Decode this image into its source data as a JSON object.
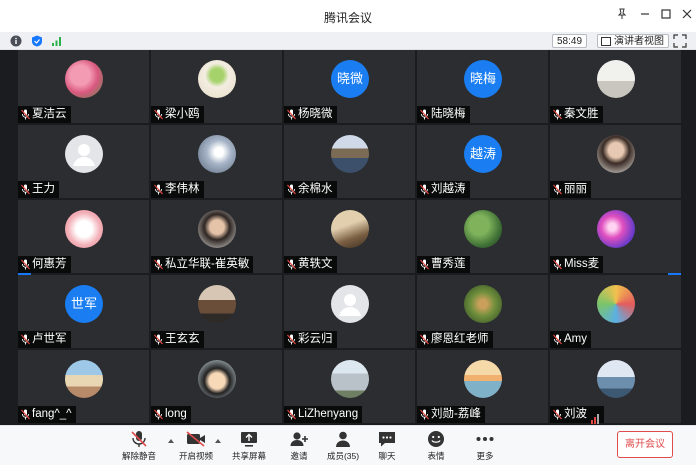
{
  "window": {
    "title": "腾讯会议"
  },
  "infobar": {
    "timer": "58:49",
    "speaker_view_label": "演讲者视图"
  },
  "participants": [
    {
      "name": "夏洁云",
      "avatar": "photo-pink-flowers"
    },
    {
      "name": "梁小鸥",
      "avatar": "photo-sprout"
    },
    {
      "name": "杨晓微",
      "avatar_text": "晓微"
    },
    {
      "name": "陆晓梅",
      "avatar_text": "晓梅"
    },
    {
      "name": "秦文胜",
      "avatar": "photo-room"
    },
    {
      "name": "王力",
      "avatar": "default-person"
    },
    {
      "name": "李伟林",
      "avatar": "photo-tunnel"
    },
    {
      "name": "余棉水",
      "avatar": "photo-arch-bridge"
    },
    {
      "name": "刘越涛",
      "avatar_text": "越涛"
    },
    {
      "name": "丽丽",
      "avatar": "photo-woman"
    },
    {
      "name": "何惠芳",
      "avatar": "photo-cartoon"
    },
    {
      "name": "私立华联-崔英敏",
      "avatar": "photo-woman-glasses"
    },
    {
      "name": "黄轶文",
      "avatar": "photo-silhouettes"
    },
    {
      "name": "曹秀莲",
      "avatar": "photo-lotus-leaves"
    },
    {
      "name": "Miss麦",
      "avatar": "photo-purple-swirl"
    },
    {
      "name": "卢世军",
      "avatar_text": "世军"
    },
    {
      "name": "王玄玄",
      "avatar": "photo-group"
    },
    {
      "name": "彩云归",
      "avatar": "default-person"
    },
    {
      "name": "廖恩红老师",
      "avatar": "photo-plant"
    },
    {
      "name": "Amy",
      "avatar": "photo-colorful-blocks"
    },
    {
      "name": "fang^_^",
      "avatar": "photo-beach"
    },
    {
      "name": "long",
      "avatar": "photo-cartoon-boy"
    },
    {
      "name": "LiZhenyang",
      "avatar": "photo-building"
    },
    {
      "name": "刘勋-荔峰",
      "avatar": "photo-sunset-sea"
    },
    {
      "name": "刘波",
      "avatar": "photo-seascape",
      "speaking": true
    }
  ],
  "toolbar": {
    "mute_label": "解除静音",
    "video_label": "开启视频",
    "share_label": "共享屏幕",
    "invite_label": "邀请",
    "members_label": "成员(35)",
    "chat_label": "聊天",
    "reactions_label": "表情",
    "more_label": "更多",
    "leave_label": "离开会议"
  },
  "colors": {
    "accent": "#1677ff",
    "grid_bg": "#1b1c1f",
    "tile_bg": "#2b2d31",
    "danger": "#e04b4b",
    "muted_red": "#e4473f"
  }
}
